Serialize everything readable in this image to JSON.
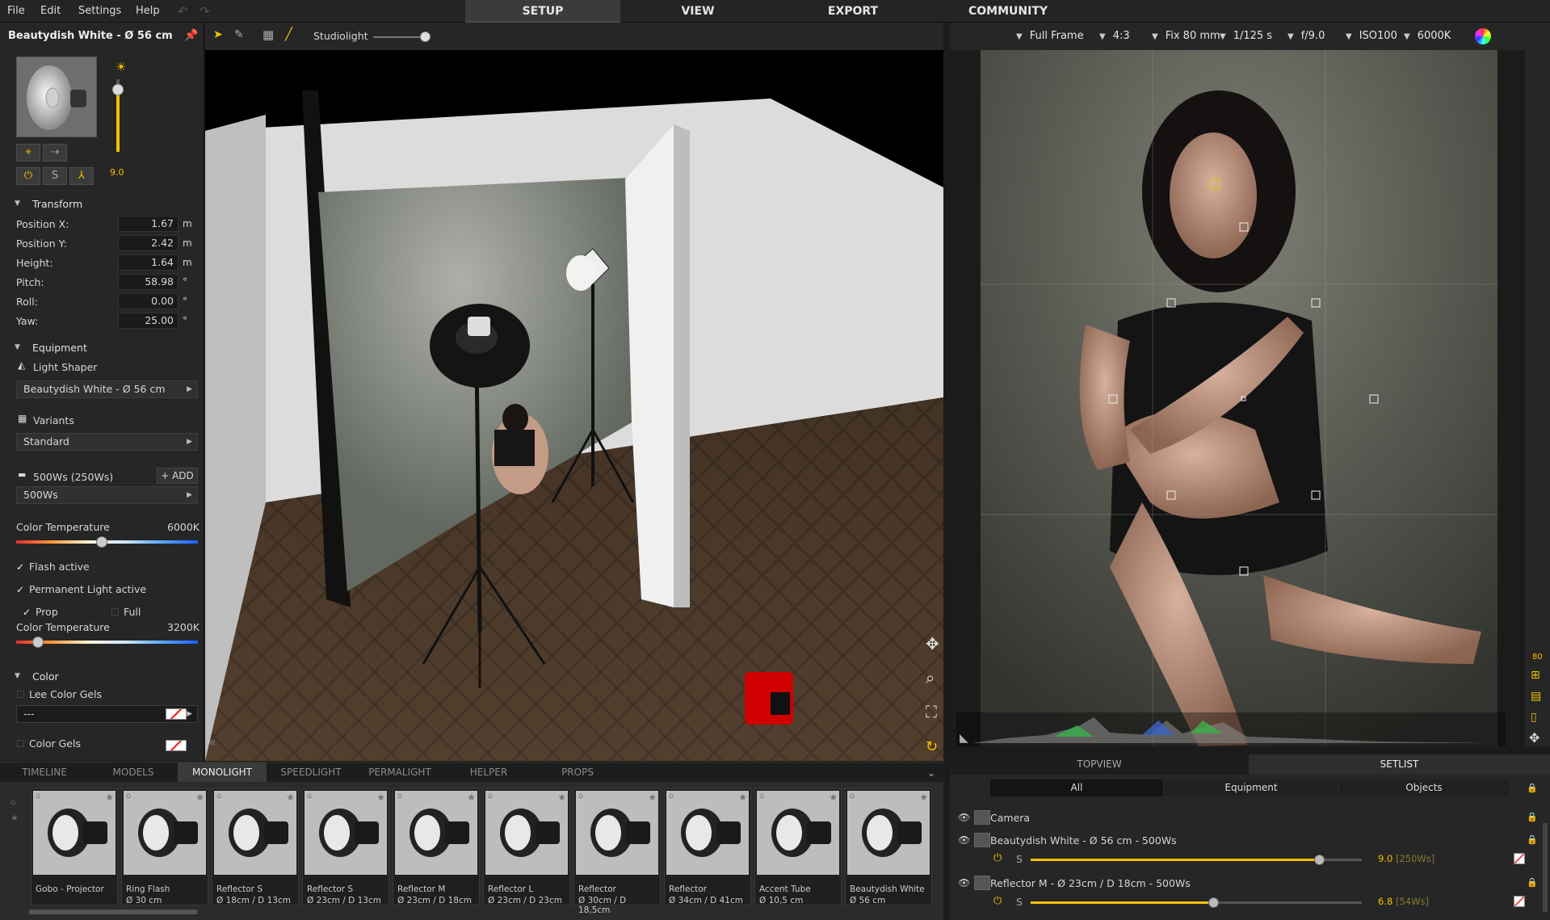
{
  "menu": {
    "file": "File",
    "edit": "Edit",
    "settings": "Settings",
    "help": "Help"
  },
  "main_tabs": {
    "setup": "SETUP",
    "view": "VIEW",
    "export": "EXPORT",
    "community": "COMMUNITY"
  },
  "left": {
    "title": "Beautydish White - Ø 56 cm",
    "power_value": "9.0",
    "s_label": "S",
    "transform": {
      "title": "Transform",
      "rows": [
        {
          "label": "Position X:",
          "value": "1.67",
          "unit": "m"
        },
        {
          "label": "Position Y:",
          "value": "2.42",
          "unit": "m"
        },
        {
          "label": "Height:",
          "value": "1.64",
          "unit": "m"
        },
        {
          "label": "Pitch:",
          "value": "58.98",
          "unit": "°"
        },
        {
          "label": "Roll:",
          "value": "0.00",
          "unit": "°"
        },
        {
          "label": "Yaw:",
          "value": "25.00",
          "unit": "°"
        }
      ]
    },
    "equipment": {
      "title": "Equipment",
      "light_shaper_label": "Light Shaper",
      "light_shaper_value": "Beautydish White - Ø 56 cm",
      "variants_label": "Variants",
      "variants_value": "Standard",
      "power_label": "500Ws (250Ws)",
      "add_label": "+ ADD",
      "power_value": "500Ws",
      "color_temp_label": "Color Temperature",
      "color_temp_value": "6000K",
      "color_temp_fraction": 0.47,
      "flash_active": "Flash active",
      "perm_active": "Permanent Light active",
      "prop": "Prop",
      "full": "Full",
      "color_temp2_label": "Color Temperature",
      "color_temp2_value": "3200K",
      "color_temp2_fraction": 0.12
    },
    "color": {
      "title": "Color",
      "lee_label": "Lee Color Gels",
      "lee_value": "---",
      "gels_label": "Color Gels"
    }
  },
  "viewport": {
    "studiolight_label": "Studiolight",
    "studiolight_fraction": 1.0
  },
  "camera": {
    "sensor": "Full Frame",
    "ratio": "4:3",
    "lens": "Fix 80 mm",
    "shutter": "1/125 s",
    "aperture": "f/9.0",
    "iso": "ISO100",
    "wb": "6000K",
    "af_label": "80"
  },
  "bottom_tabs": [
    "TIMELINE",
    "MODELS",
    "MONOLIGHT",
    "SPEEDLIGHT",
    "PERMALIGHT",
    "HELPER",
    "PROPS"
  ],
  "bottom_active": "MONOLIGHT",
  "shelf": [
    {
      "l1": "Gobo - Projector",
      "l2": ""
    },
    {
      "l1": "Ring Flash",
      "l2": "Ø 30 cm"
    },
    {
      "l1": "Reflector S",
      "l2": "Ø 18cm / D 13cm"
    },
    {
      "l1": "Reflector S",
      "l2": "Ø 23cm / D 13cm"
    },
    {
      "l1": "Reflector M",
      "l2": "Ø 23cm / D 18cm"
    },
    {
      "l1": "Reflector L",
      "l2": "Ø 23cm / D 23cm"
    },
    {
      "l1": "Reflector",
      "l2": "Ø 30cm / D 18,5cm"
    },
    {
      "l1": "Reflector",
      "l2": "Ø 34cm / D 41cm"
    },
    {
      "l1": "Accent Tube",
      "l2": "Ø 10,5 cm"
    },
    {
      "l1": "Beautydish White",
      "l2": "Ø 56 cm"
    }
  ],
  "right_tabs": {
    "topview": "TOPVIEW",
    "setlist": "SETLIST"
  },
  "filters": {
    "all": "All",
    "equipment": "Equipment",
    "objects": "Objects"
  },
  "setlist": {
    "camera": "Camera",
    "light1": {
      "name": "Beautydish White - Ø 56 cm - 500Ws",
      "s": "S",
      "value": "9.0",
      "extra": "[250Ws]",
      "fraction": 0.87
    },
    "light2": {
      "name": "Reflector M - Ø 23cm / D 18cm - 500Ws",
      "s": "S",
      "value": "6.8",
      "extra": "[54Ws]",
      "fraction": 0.55
    }
  }
}
